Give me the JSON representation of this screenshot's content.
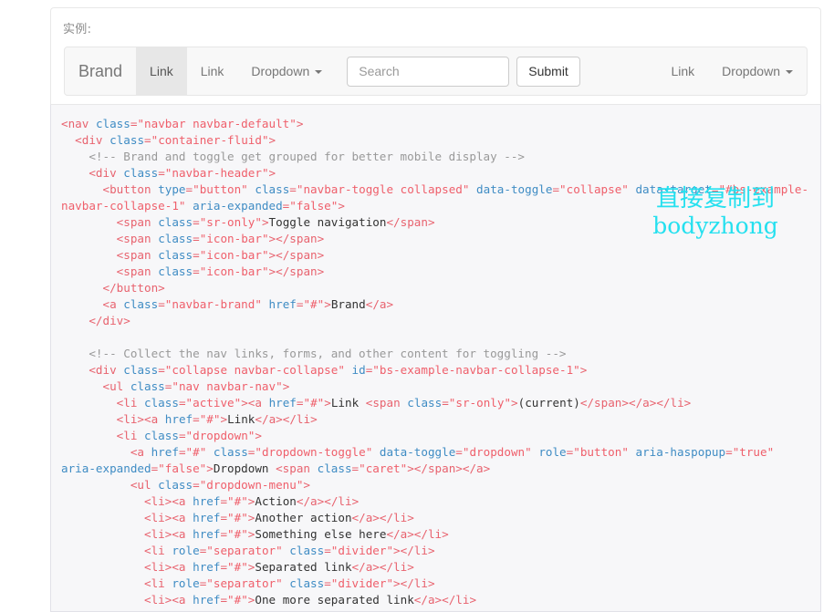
{
  "panel": {
    "label": "实例:"
  },
  "navbar": {
    "brand": "Brand",
    "left_items": [
      {
        "label": "Link",
        "active": true,
        "caret": false
      },
      {
        "label": "Link",
        "active": false,
        "caret": false
      },
      {
        "label": "Dropdown",
        "active": false,
        "caret": true
      }
    ],
    "form": {
      "search_placeholder": "Search",
      "search_value": "",
      "submit_label": "Submit"
    },
    "right_items": [
      {
        "label": "Link",
        "active": false,
        "caret": false
      },
      {
        "label": "Dropdown",
        "active": false,
        "caret": true
      }
    ]
  },
  "code": {
    "language": "html",
    "lines": [
      "<nav class=\"navbar navbar-default\">",
      "  <div class=\"container-fluid\">",
      "    <!-- Brand and toggle get grouped for better mobile display -->",
      "    <div class=\"navbar-header\">",
      "      <button type=\"button\" class=\"navbar-toggle collapsed\" data-toggle=\"collapse\" data-target=\"#bs-example-navbar-collapse-1\" aria-expanded=\"false\">",
      "        <span class=\"sr-only\">Toggle navigation</span>",
      "        <span class=\"icon-bar\"></span>",
      "        <span class=\"icon-bar\"></span>",
      "        <span class=\"icon-bar\"></span>",
      "      </button>",
      "      <a class=\"navbar-brand\" href=\"#\">Brand</a>",
      "    </div>",
      "",
      "    <!-- Collect the nav links, forms, and other content for toggling -->",
      "    <div class=\"collapse navbar-collapse\" id=\"bs-example-navbar-collapse-1\">",
      "      <ul class=\"nav navbar-nav\">",
      "        <li class=\"active\"><a href=\"#\">Link <span class=\"sr-only\">(current)</span></a></li>",
      "        <li><a href=\"#\">Link</a></li>",
      "        <li class=\"dropdown\">",
      "          <a href=\"#\" class=\"dropdown-toggle\" data-toggle=\"dropdown\" role=\"button\" aria-haspopup=\"true\" aria-expanded=\"false\">Dropdown <span class=\"caret\"></span></a>",
      "          <ul class=\"dropdown-menu\">",
      "            <li><a href=\"#\">Action</a></li>",
      "            <li><a href=\"#\">Another action</a></li>",
      "            <li><a href=\"#\">Something else here</a></li>",
      "            <li role=\"separator\" class=\"divider\"></li>",
      "            <li><a href=\"#\">Separated link</a></li>",
      "            <li role=\"separator\" class=\"divider\"></li>",
      "            <li><a href=\"#\">One more separated link</a></li>"
    ]
  },
  "watermark": {
    "line1": "直接复制到",
    "line2": "bodyzhong",
    "color": "#25e0ef"
  },
  "colors": {
    "page_background": "#ffffff",
    "panel_border": "#e8e8e8",
    "navbar_background": "#f8f8f8",
    "navbar_border": "#e7e7e7",
    "navbar_active_background": "#e7e7e7",
    "code_background": "#f7f7f9",
    "code_border": "#e1e1e8",
    "code_text": "#333333",
    "code_tag": "#e8636f",
    "code_attr": "#3f8cc4",
    "code_value": "#ef5f6b",
    "code_comment": "#999999",
    "label_text": "#8a8a8a",
    "nav_link_text": "#777777"
  }
}
